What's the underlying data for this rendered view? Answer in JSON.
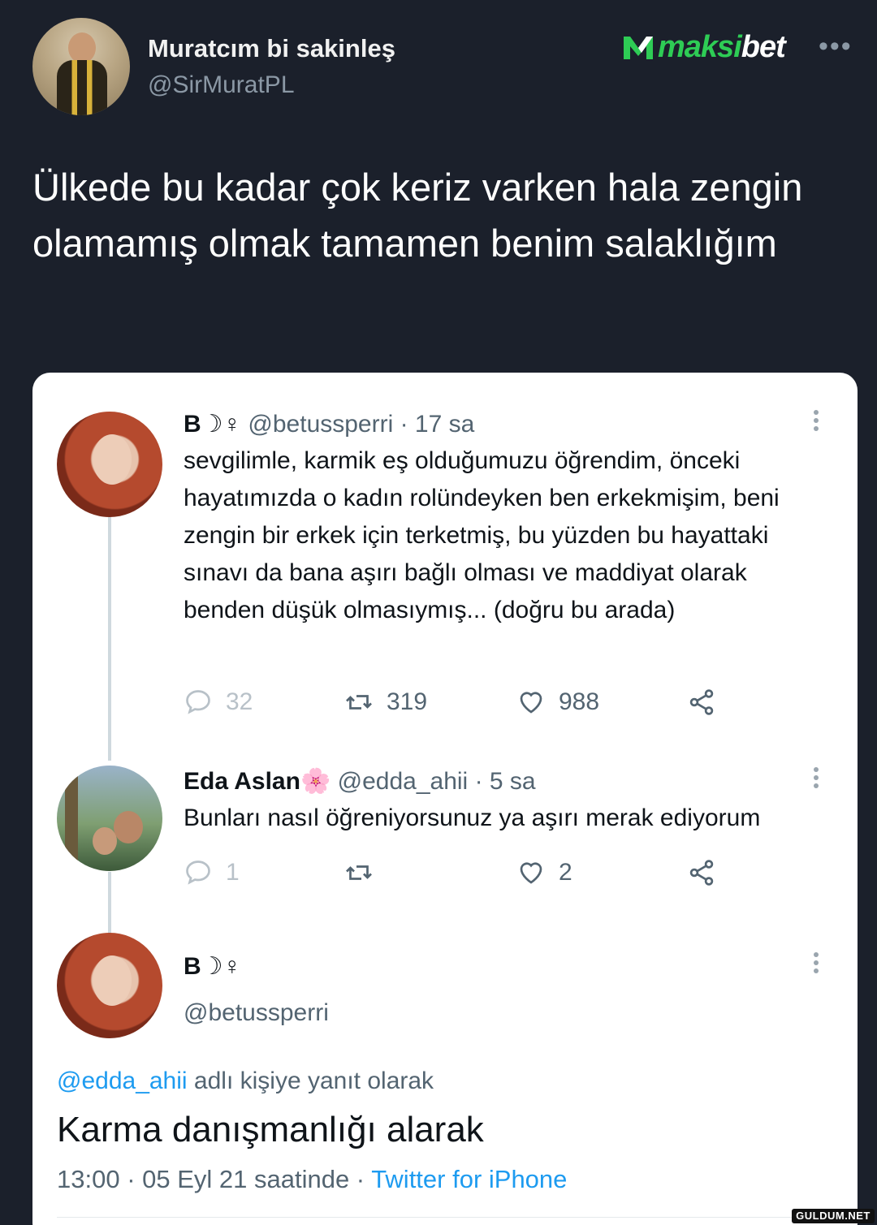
{
  "outer": {
    "name": "Muratcım bi sakinleş",
    "handle": "@SirMuratPL",
    "text": "Ülkede bu kadar çok keriz varken hala zengin olamamış olmak tamamen benim salaklığım",
    "brand_prefix": "maksi",
    "brand_suffix": "bet",
    "more": "•••"
  },
  "tweet1": {
    "name": "B☽♀",
    "handle": "@betussperri",
    "time": "· 17 sa",
    "text": "sevgilimle, karmik eş olduğumuzu öğrendim, önceki hayatımızda o kadın rolündeyken ben erkekmişim, beni zengin bir erkek için terketmiş, bu yüzden bu hayattaki sınavı da bana aşırı bağlı olması ve maddiyat olarak benden düşük olmasıymış... (doğru bu arada)",
    "replies": "32",
    "retweets": "319",
    "likes": "988"
  },
  "tweet2": {
    "name": "Eda Aslan",
    "emoji": "🌸",
    "handle": "@edda_ahii",
    "time": "· 5 sa",
    "text": "Bunları nasıl öğreniyorsunuz ya aşırı merak ediyorum",
    "replies": "1",
    "retweets": "",
    "likes": "2"
  },
  "tweet3": {
    "name": "B☽♀",
    "handle": "@betussperri",
    "reply_mention": "@edda_ahii",
    "reply_suffix": " adlı kişiye yanıt olarak",
    "text": "Karma danışmanlığı alarak",
    "timestamp": "13:00 · 05 Eyl 21 saatinde · ",
    "source": "Twitter for iPhone"
  },
  "watermark": "GULDUM.NET",
  "colors": {
    "background": "#1b202b",
    "brand_green": "#2ecc55",
    "link_blue": "#1d9bf0"
  }
}
